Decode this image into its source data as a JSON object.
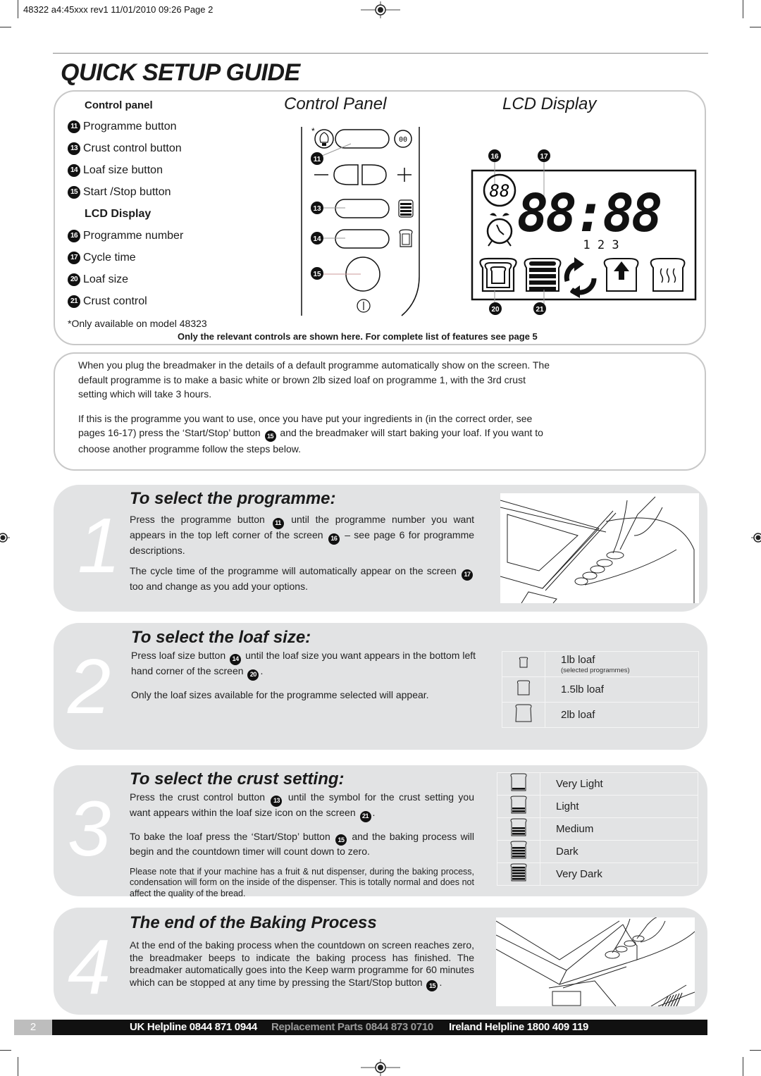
{
  "print_slug": "48322 a4:45xxx rev1  11/01/2010  09:26  Page 2",
  "title": "QUICK SETUP GUIDE",
  "overview": {
    "control_panel_heading": "Control panel",
    "control_items": [
      {
        "num": "11",
        "label": "Programme button"
      },
      {
        "num": "13",
        "label": "Crust control button"
      },
      {
        "num": "14",
        "label": "Loaf size button"
      },
      {
        "num": "15",
        "label": "Start /Stop button"
      }
    ],
    "lcd_heading": "LCD Display",
    "lcd_items": [
      {
        "num": "16",
        "label": "Programme number"
      },
      {
        "num": "17",
        "label": "Cycle time"
      },
      {
        "num": "20",
        "label": "Loaf size"
      },
      {
        "num": "21",
        "label": "Crust control"
      }
    ],
    "footnote": "*Only available on model 48323",
    "control_panel_title": "Control Panel",
    "lcd_display_title": "LCD Display",
    "diagram": {
      "asterisk": "*",
      "callouts": [
        "11",
        "13",
        "14",
        "15"
      ],
      "lcd_callouts": [
        "16",
        "17",
        "20",
        "21"
      ],
      "programme_digits": "88",
      "time_digits": "88:88",
      "stage_digits": "1 2 3"
    },
    "relevance_note": "Only the relevant controls are shown here. For complete list of features see page 5"
  },
  "intro": {
    "paragraph_1": "When you plug the breadmaker in the details of a default programme automatically show on the screen. The default programme is to make a basic white or brown 2lb sized loaf on programme 1, with the 3rd crust setting which will take 3 hours.",
    "paragraph_2_before": "If this is the programme you want to use, once you have put your ingredients in (in the correct order, see pages 16-17) press the ‘Start/Stop’ button",
    "paragraph_2_badge": "15",
    "paragraph_2_after": "and the breadmaker will start baking your loaf. If you want to choose another programme follow the steps below."
  },
  "steps": [
    {
      "number": "1",
      "heading": "To select the programme:",
      "p1_a": "Press the programme button",
      "p1_b1": "11",
      "p1_c": "until the programme number you want appears in the top left corner of the screen",
      "p1_b2": "16",
      "p1_d": "– see page 6 for programme descriptions.",
      "p2_b": "17",
      "p2": "The cycle time of the programme will automatically appear on the screen",
      "p2_c": "too and change as you add your options."
    },
    {
      "number": "2",
      "heading": "To select the loaf size:",
      "p1_a": "Press loaf size button",
      "p1_b1": "14",
      "p1_c": "until the loaf size you want appears in the bottom left hand corner of the screen",
      "p1_b2": "20",
      "p2": "Only the loaf sizes available for the programme selected will appear.",
      "options": [
        {
          "label": "1lb loaf",
          "sub": "(selected programmes)",
          "icon": "loaf-small-icon"
        },
        {
          "label": "1.5lb loaf",
          "sub": "",
          "icon": "loaf-medium-icon"
        },
        {
          "label": "2lb loaf",
          "sub": "",
          "icon": "loaf-large-icon"
        }
      ]
    },
    {
      "number": "3",
      "heading": "To select the crust setting:",
      "p1_a": "Press the crust control button",
      "p1_b1": "13",
      "p1_c": "until the symbol for the crust setting you want appears within the loaf size icon on the screen",
      "p1_b2": "21",
      "p2_a": "To bake the loaf press the ‘Start/Stop’ button",
      "p2_b": "15",
      "p2_c": "and the baking process will begin and the countdown timer will count down to zero.",
      "p3": "Please note that if your machine has a fruit & nut dispenser, during the baking process, condensation will form on the inside of the dispenser. This is totally normal and does not affect the quality of the bread.",
      "options": [
        {
          "label": "Very Light",
          "bars": 1
        },
        {
          "label": "Light",
          "bars": 2
        },
        {
          "label": "Medium",
          "bars": 3
        },
        {
          "label": "Dark",
          "bars": 4
        },
        {
          "label": "Very Dark",
          "bars": 5
        }
      ]
    },
    {
      "number": "4",
      "heading": "The end of the Baking Process",
      "p1": "At the end of the baking process when the countdown on screen reaches zero, the breadmaker beeps to indicate the baking process has finished. The breadmaker automatically goes into the Keep warm programme for 60 minutes which can be stopped at any time by pressing the Start/Stop button",
      "p1_b": "15"
    }
  ],
  "footer": {
    "page_number": "2",
    "uk_helpline": "UK Helpline 0844 871 0944",
    "replacement_parts": "Replacement Parts 0844 873 0710",
    "ireland_helpline": "Ireland Helpline 1800 409 119"
  }
}
